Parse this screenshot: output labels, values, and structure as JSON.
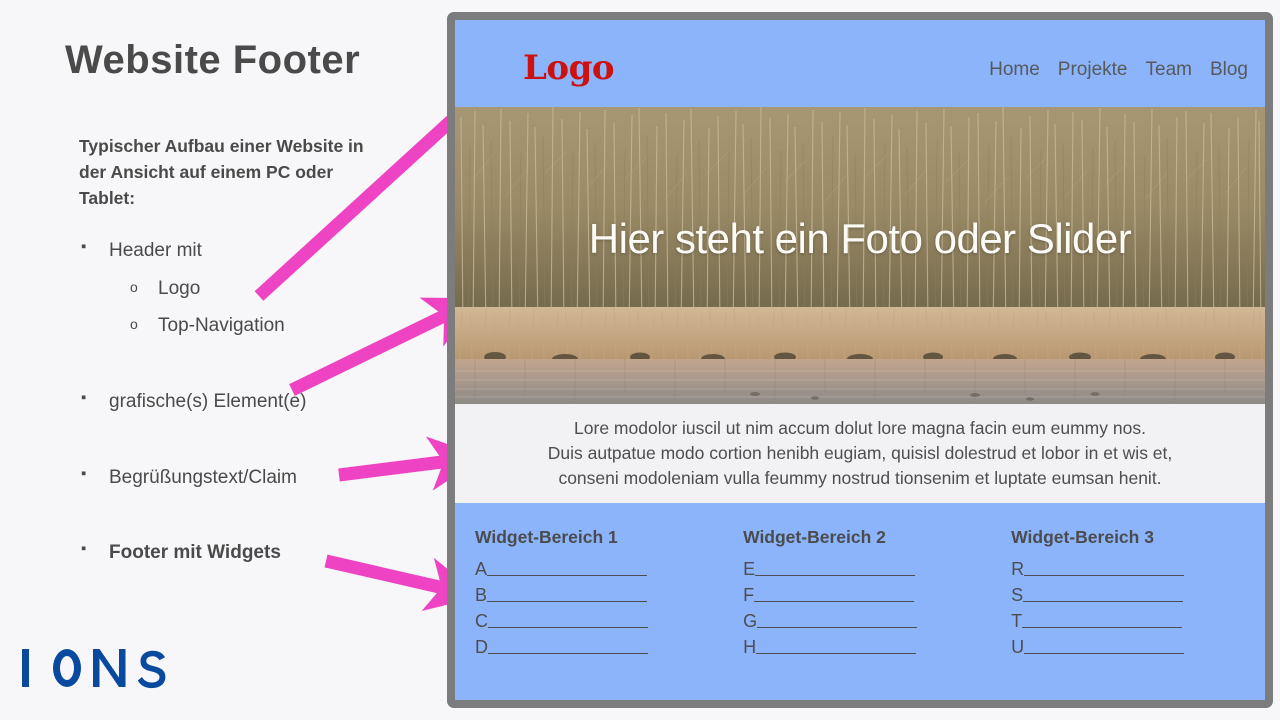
{
  "slide": {
    "title": "Website Footer",
    "intro": "Typischer Aufbau einer Website in der Ansicht auf einem PC oder Tablet:",
    "bullets": [
      {
        "level": 1,
        "label": "Header mit",
        "bold": false,
        "spacing": "sp-0"
      },
      {
        "level": 2,
        "label": "Logo",
        "bold": false,
        "spacing": "sp-1"
      },
      {
        "level": 2,
        "label": "Top-Navigation",
        "bold": false,
        "spacing": "sp-2"
      },
      {
        "level": 1,
        "label": "grafische(s) Element(e)",
        "bold": false,
        "spacing": "sp-3"
      },
      {
        "level": 1,
        "label": "Begrüßungstext/Claim",
        "bold": false,
        "spacing": "sp-4"
      },
      {
        "level": 1,
        "label": "Footer mit Widgets",
        "bold": true,
        "spacing": "sp-5"
      }
    ],
    "brand": {
      "name": "IONOS",
      "color": "#0a4a9e"
    },
    "background_color": "#f7f6f8",
    "text_color": "#4a4a4a",
    "arrow_color": "#ee44c4"
  },
  "mockup": {
    "frame_color": "#7c7c7c",
    "accent_blue": "#8cb4fb",
    "claim_background": "#f2f1f3",
    "header": {
      "logo_text": "Logo",
      "logo_color": "#cc1111",
      "nav": [
        {
          "label": "Home"
        },
        {
          "label": "Projekte"
        },
        {
          "label": "Team"
        },
        {
          "label": "Blog"
        }
      ]
    },
    "hero": {
      "caption": "Hier steht ein Foto oder Slider",
      "caption_color": "#fcfaf5"
    },
    "claim": {
      "text": "Lore modolor iuscil ut nim accum dolut lore magna facin eum eummy nos.\nDuis autpatue modo cortion henibh eugiam, quisisl dolestrud et lobor in et wis et,\nconseni modoleniam vulla feummy nostrud tionsenim et luptate eumsan henit."
    },
    "widgets": [
      {
        "title": "Widget-Bereich 1",
        "items": [
          "A",
          "B",
          "C",
          "D"
        ]
      },
      {
        "title": "Widget-Bereich 2",
        "items": [
          "E",
          "F",
          "G",
          "H"
        ]
      },
      {
        "title": "Widget-Bereich 3",
        "items": [
          "R",
          "S",
          "T",
          "U"
        ]
      }
    ]
  }
}
